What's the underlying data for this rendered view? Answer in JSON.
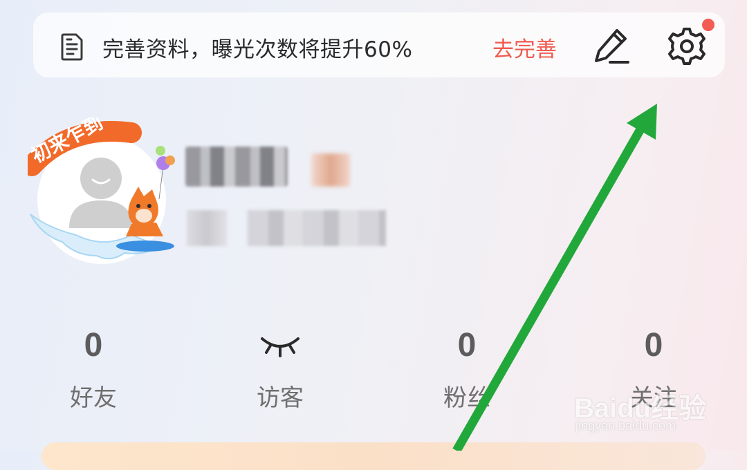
{
  "banner": {
    "text": "完善资料，曝光次数将提升60%",
    "action_label": "去完善",
    "icons": [
      "document-icon",
      "edit-icon",
      "settings-icon"
    ],
    "notification_dot_color": "#f45b52"
  },
  "profile": {
    "badge_text": "初来乍到"
  },
  "stats": [
    {
      "value": "0",
      "label": "好友"
    },
    {
      "value": "",
      "label": "访客",
      "icon": "closed-eye-icon"
    },
    {
      "value": "0",
      "label": "粉丝"
    },
    {
      "value": "0",
      "label": "关注"
    }
  ],
  "watermark": {
    "brand": "Baidu经验",
    "url": "jingyan.baidu.com"
  },
  "colors": {
    "accent": "#f05a4f",
    "arrow": "#22a83a"
  }
}
